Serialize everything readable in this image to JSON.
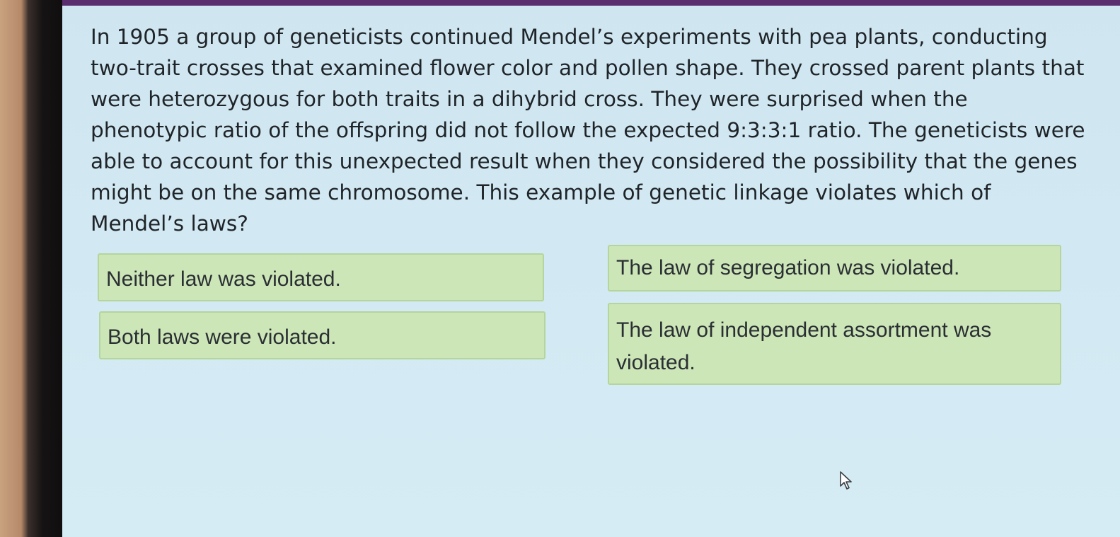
{
  "question": {
    "text": "In 1905 a group of geneticists continued Mendel’s experiments with pea plants, conducting two-trait crosses that examined flower color and pollen shape. They crossed parent plants that were heterozygous for both traits in a dihybrid cross. They were surprised when the phenotypic ratio of the offspring did not follow the expected 9:3:3:1 ratio. The geneticists were able to account for this unexpected result when they considered the possibility that the genes might be on the same chromosome. This example of genetic linkage violates which of Mendel’s laws?"
  },
  "options": [
    {
      "label": "Neither law was violated."
    },
    {
      "label": "The law of segregation was violated."
    },
    {
      "label": "Both laws were violated."
    },
    {
      "label": "The law of independent assortment was violated."
    }
  ],
  "colors": {
    "screen_background": "#d3e9f3",
    "top_bar": "#5a2d6e",
    "option_background": "#cde6b8",
    "option_border": "#b4d59c",
    "text": "#1f2428"
  },
  "icons": {
    "pointer": "mouse-pointer-icon"
  }
}
